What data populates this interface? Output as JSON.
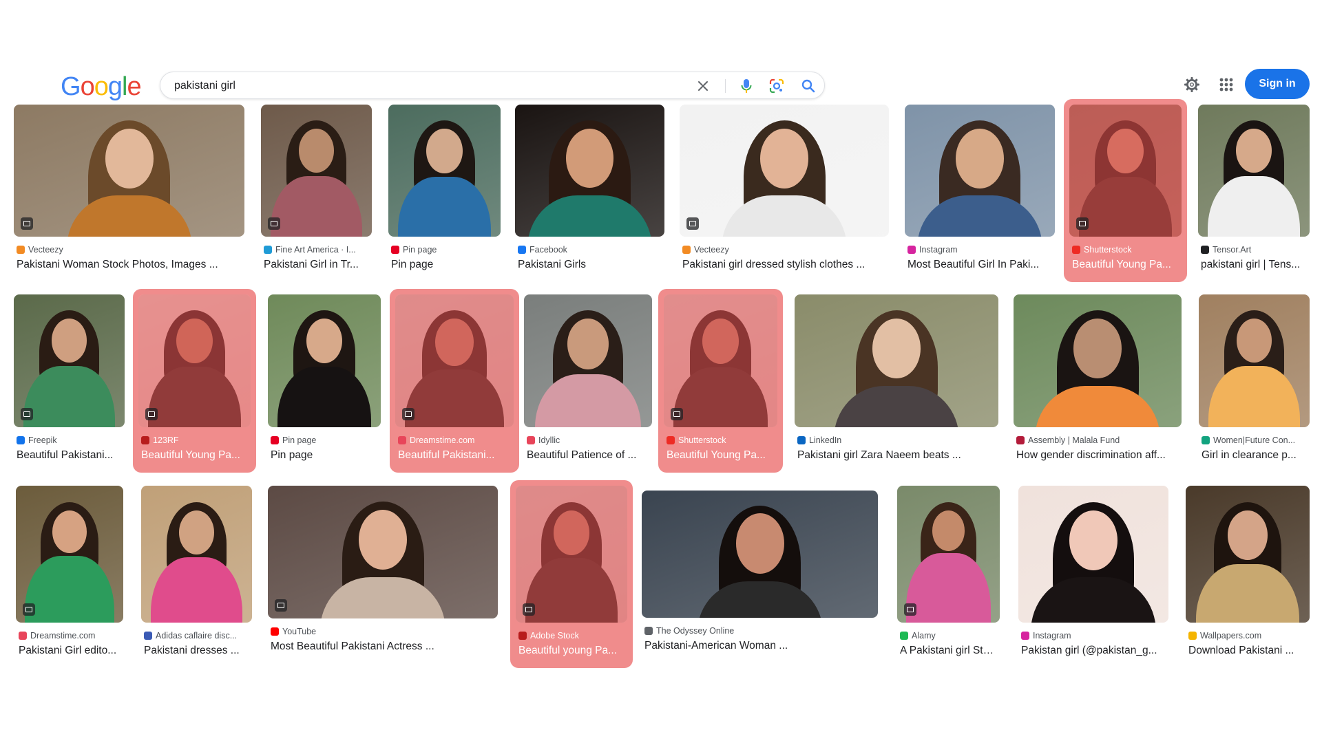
{
  "header": {
    "logo_letters": [
      {
        "char": "G",
        "color": "#4285F4"
      },
      {
        "char": "o",
        "color": "#EA4335"
      },
      {
        "char": "o",
        "color": "#FBBC05"
      },
      {
        "char": "g",
        "color": "#4285F4"
      },
      {
        "char": "l",
        "color": "#34A853"
      },
      {
        "char": "e",
        "color": "#EA4335"
      }
    ],
    "search_query": "pakistani girl",
    "sign_in_label": "Sign in",
    "icons": [
      "clear-icon",
      "mic-icon",
      "lens-icon",
      "search-icon",
      "settings-icon",
      "apps-icon"
    ]
  },
  "results": [
    {
      "source": "Vecteezy",
      "title": "Pakistani Woman Stock Photos, Images ...",
      "favicon_color": "#f28b24",
      "highlighted": false,
      "badge": true
    },
    {
      "source": "Fine Art America · I...",
      "title": "Pakistani Girl in Tr...",
      "favicon_color": "#1f9bd6",
      "highlighted": false,
      "badge": true
    },
    {
      "source": "Pin page",
      "title": "Pin page",
      "favicon_color": "#e60023",
      "highlighted": false,
      "badge": false
    },
    {
      "source": "Facebook",
      "title": "Pakistani Girls",
      "favicon_color": "#1877f2",
      "highlighted": false,
      "badge": false
    },
    {
      "source": "Vecteezy",
      "title": "Pakistani girl dressed stylish clothes ...",
      "favicon_color": "#f28b24",
      "highlighted": false,
      "badge": true
    },
    {
      "source": "Instagram",
      "title": "Most Beautiful Girl In Paki...",
      "favicon_color": "#d6249f",
      "highlighted": false,
      "badge": false
    },
    {
      "source": "Shutterstock",
      "title": "Beautiful Young Pa...",
      "favicon_color": "#ee2b24",
      "highlighted": true,
      "badge": true
    },
    {
      "source": "Tensor.Art",
      "title": "pakistani girl | Tens...",
      "favicon_color": "#202124",
      "highlighted": false,
      "badge": false
    },
    {
      "source": "Freepik",
      "title": "Beautiful Pakistani...",
      "favicon_color": "#1273eb",
      "highlighted": false,
      "badge": true
    },
    {
      "source": "123RF",
      "title": "Beautiful Young Pa...",
      "favicon_color": "#b71c1c",
      "highlighted": true,
      "badge": true
    },
    {
      "source": "Pin page",
      "title": "Pin page",
      "favicon_color": "#e60023",
      "highlighted": false,
      "badge": false
    },
    {
      "source": "Dreamstime.com",
      "title": "Beautiful Pakistani...",
      "favicon_color": "#e8455a",
      "highlighted": true,
      "badge": true
    },
    {
      "source": "Idyllic",
      "title": "Beautiful Patience of ...",
      "favicon_color": "#e8455a",
      "highlighted": false,
      "badge": false
    },
    {
      "source": "Shutterstock",
      "title": "Beautiful Young Pa...",
      "favicon_color": "#ee2b24",
      "highlighted": true,
      "badge": true
    },
    {
      "source": "LinkedIn",
      "title": "Pakistani girl Zara Naeem beats ...",
      "favicon_color": "#0a66c2",
      "highlighted": false,
      "badge": false
    },
    {
      "source": "Assembly | Malala Fund",
      "title": "How gender discrimination aff...",
      "favicon_color": "#b31b3a",
      "highlighted": false,
      "badge": false
    },
    {
      "source": "Women|Future Con...",
      "title": "Girl in clearance p...",
      "favicon_color": "#12a37f",
      "highlighted": false,
      "badge": false
    },
    {
      "source": "Dreamstime.com",
      "title": "Pakistani Girl edito...",
      "favicon_color": "#e8455a",
      "highlighted": false,
      "badge": true
    },
    {
      "source": "Adidas caflaire disc...",
      "title": "Pakistani dresses ...",
      "favicon_color": "#3b5bb5",
      "highlighted": false,
      "badge": false
    },
    {
      "source": "YouTube",
      "title": "Most Beautiful Pakistani Actress ...",
      "favicon_color": "#ff0000",
      "highlighted": false,
      "badge": true
    },
    {
      "source": "Adobe Stock",
      "title": "Beautiful young Pa...",
      "favicon_color": "#b71c1c",
      "highlighted": true,
      "badge": true
    },
    {
      "source": "The Odyssey Online",
      "title": "Pakistani-American Woman ...",
      "favicon_color": "#5f6368",
      "highlighted": false,
      "badge": false
    },
    {
      "source": "Alamy",
      "title": "A Pakistani girl Sto...",
      "favicon_color": "#1db954",
      "highlighted": false,
      "badge": true
    },
    {
      "source": "Instagram",
      "title": "Pakistan girl (@pakistan_g...",
      "favicon_color": "#d6249f",
      "highlighted": false,
      "badge": false
    },
    {
      "source": "Wallpapers.com",
      "title": "Download Pakistani ...",
      "favicon_color": "#f4b400",
      "highlighted": false,
      "badge": false
    }
  ]
}
